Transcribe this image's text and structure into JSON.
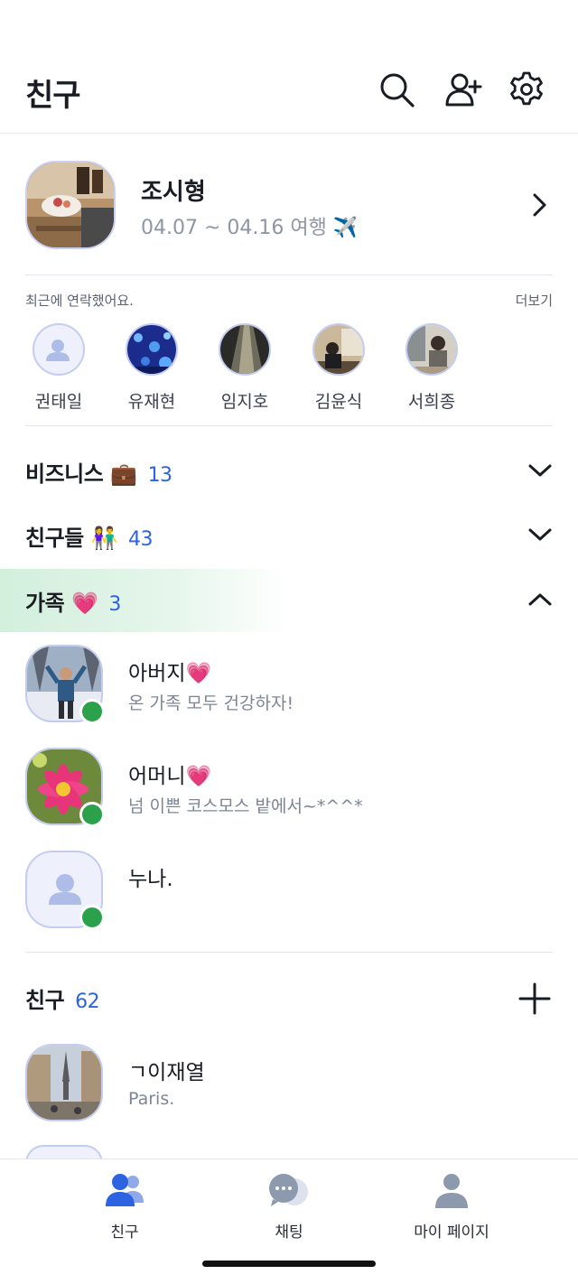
{
  "header": {
    "title": "친구",
    "icons": [
      "search-icon",
      "add-friend-icon",
      "settings-icon"
    ]
  },
  "profile": {
    "name": "조시형",
    "status": "04.07 ~ 04.16 여행 ✈️"
  },
  "recent": {
    "label": "최근에 연락했어요.",
    "more": "더보기",
    "people": [
      {
        "name": "권태일"
      },
      {
        "name": "유재현"
      },
      {
        "name": "임지호"
      },
      {
        "name": "김윤식"
      },
      {
        "name": "서희종"
      }
    ]
  },
  "groups": [
    {
      "name": "비즈니스 💼",
      "count": "13",
      "expanded": false
    },
    {
      "name": "친구들 👫",
      "count": "43",
      "expanded": false
    },
    {
      "name": "가족 💗",
      "count": "3",
      "expanded": true
    }
  ],
  "family": [
    {
      "name": "아버지💗",
      "message": "온 가족 모두 건강하자!",
      "online": true
    },
    {
      "name": "어머니💗",
      "message": "넘 이쁜 코스모스 밭에서~*^^*",
      "online": true
    },
    {
      "name": "누나.",
      "message": "",
      "online": true
    }
  ],
  "friends_section": {
    "title": "친구",
    "count": "62"
  },
  "friends": [
    {
      "name": "ㄱ이재열",
      "message": "Paris."
    }
  ],
  "tabs": [
    {
      "label": "친구",
      "icon": "friends-icon",
      "active": true
    },
    {
      "label": "채팅",
      "icon": "chat-icon",
      "active": false
    },
    {
      "label": "마이 페이지",
      "icon": "my-page-icon",
      "active": false
    }
  ],
  "colors": {
    "accent": "#2c63e0",
    "online": "#2aa14a",
    "muted": "#7d8494"
  }
}
